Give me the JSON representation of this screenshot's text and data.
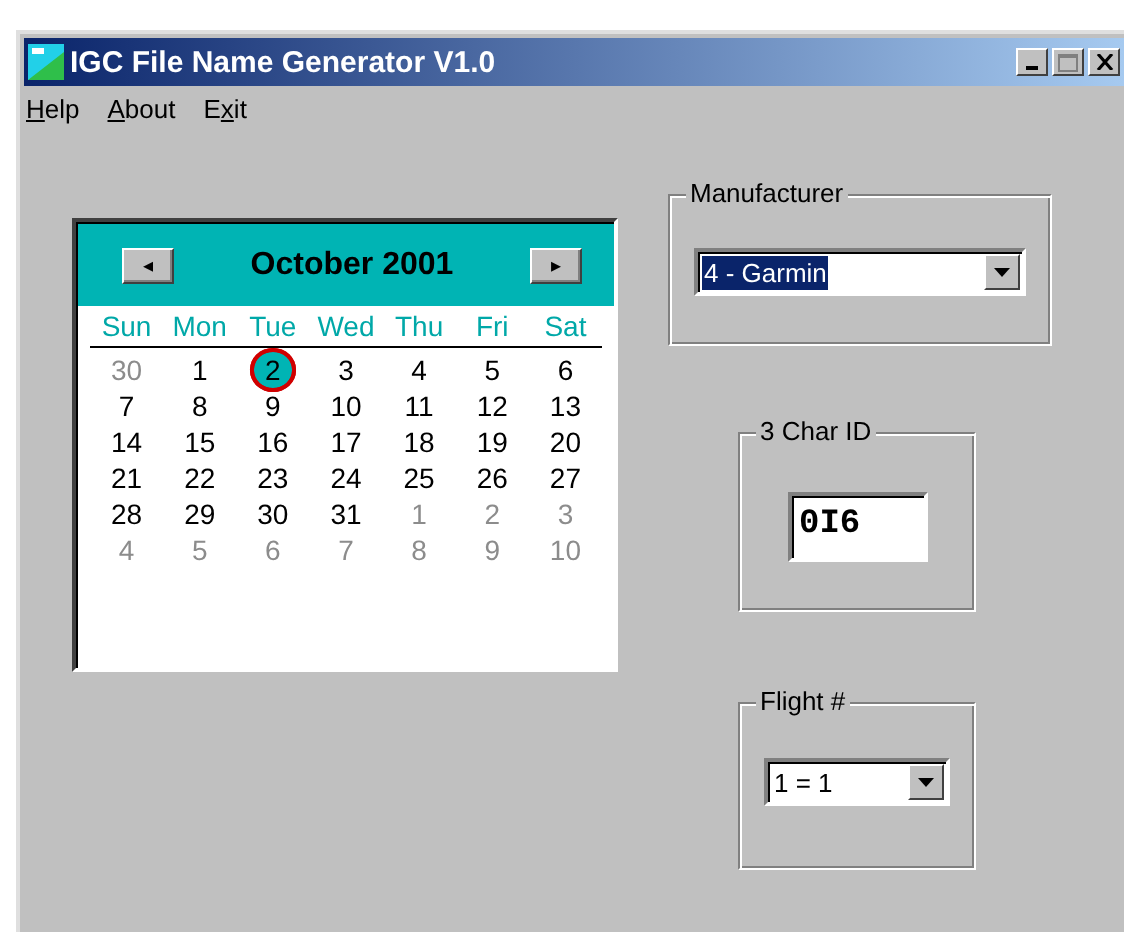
{
  "window": {
    "title": "IGC File Name Generator V1.0"
  },
  "menu": [
    {
      "label": "Help",
      "first_letter_underlined": true,
      "second_letter_underlined": false
    },
    {
      "label": "About",
      "first_letter_underlined": true,
      "second_letter_underlined": false
    },
    {
      "label": "Exit",
      "first_letter_underlined": false,
      "second_letter_underlined": true
    }
  ],
  "calendar": {
    "month": "October 2001",
    "prev": "◂",
    "next": "▸",
    "weekdays": [
      "Sun",
      "Mon",
      "Tue",
      "Wed",
      "Thu",
      "Fri",
      "Sat"
    ],
    "weeks": [
      [
        {
          "day": "30",
          "in_month": false,
          "selected": false,
          "circled": false
        },
        {
          "day": "1",
          "in_month": true,
          "selected": false,
          "circled": false
        },
        {
          "day": "2",
          "in_month": true,
          "selected": true,
          "circled": true
        },
        {
          "day": "3",
          "in_month": true,
          "selected": false,
          "circled": false
        },
        {
          "day": "4",
          "in_month": true,
          "selected": false,
          "circled": false
        },
        {
          "day": "5",
          "in_month": true,
          "selected": false,
          "circled": false
        },
        {
          "day": "6",
          "in_month": true,
          "selected": false,
          "circled": false
        }
      ],
      [
        {
          "day": "7",
          "in_month": true,
          "selected": false,
          "circled": false
        },
        {
          "day": "8",
          "in_month": true,
          "selected": false,
          "circled": false
        },
        {
          "day": "9",
          "in_month": true,
          "selected": false,
          "circled": false
        },
        {
          "day": "10",
          "in_month": true,
          "selected": false,
          "circled": false
        },
        {
          "day": "11",
          "in_month": true,
          "selected": false,
          "circled": false
        },
        {
          "day": "12",
          "in_month": true,
          "selected": false,
          "circled": false
        },
        {
          "day": "13",
          "in_month": true,
          "selected": false,
          "circled": false
        }
      ],
      [
        {
          "day": "14",
          "in_month": true,
          "selected": false,
          "circled": false
        },
        {
          "day": "15",
          "in_month": true,
          "selected": false,
          "circled": false
        },
        {
          "day": "16",
          "in_month": true,
          "selected": false,
          "circled": false
        },
        {
          "day": "17",
          "in_month": true,
          "selected": false,
          "circled": false
        },
        {
          "day": "18",
          "in_month": true,
          "selected": false,
          "circled": false
        },
        {
          "day": "19",
          "in_month": true,
          "selected": false,
          "circled": false
        },
        {
          "day": "20",
          "in_month": true,
          "selected": false,
          "circled": false
        }
      ],
      [
        {
          "day": "21",
          "in_month": true,
          "selected": false,
          "circled": false
        },
        {
          "day": "22",
          "in_month": true,
          "selected": false,
          "circled": false
        },
        {
          "day": "23",
          "in_month": true,
          "selected": false,
          "circled": false
        },
        {
          "day": "24",
          "in_month": true,
          "selected": false,
          "circled": false
        },
        {
          "day": "25",
          "in_month": true,
          "selected": false,
          "circled": false
        },
        {
          "day": "26",
          "in_month": true,
          "selected": false,
          "circled": false
        },
        {
          "day": "27",
          "in_month": true,
          "selected": false,
          "circled": false
        }
      ],
      [
        {
          "day": "28",
          "in_month": true,
          "selected": false,
          "circled": false
        },
        {
          "day": "29",
          "in_month": true,
          "selected": false,
          "circled": false
        },
        {
          "day": "30",
          "in_month": true,
          "selected": false,
          "circled": false
        },
        {
          "day": "31",
          "in_month": true,
          "selected": false,
          "circled": false
        },
        {
          "day": "1",
          "in_month": false,
          "selected": false,
          "circled": false
        },
        {
          "day": "2",
          "in_month": false,
          "selected": false,
          "circled": false
        },
        {
          "day": "3",
          "in_month": false,
          "selected": false,
          "circled": false
        }
      ],
      [
        {
          "day": "4",
          "in_month": false,
          "selected": false,
          "circled": false
        },
        {
          "day": "5",
          "in_month": false,
          "selected": false,
          "circled": false
        },
        {
          "day": "6",
          "in_month": false,
          "selected": false,
          "circled": false
        },
        {
          "day": "7",
          "in_month": false,
          "selected": false,
          "circled": false
        },
        {
          "day": "8",
          "in_month": false,
          "selected": false,
          "circled": false
        },
        {
          "day": "9",
          "in_month": false,
          "selected": false,
          "circled": false
        },
        {
          "day": "10",
          "in_month": false,
          "selected": false,
          "circled": false
        }
      ]
    ]
  },
  "manufacturer": {
    "label": "Manufacturer",
    "value": "4 - Garmin",
    "highlighted": true
  },
  "char_id": {
    "label": "3 Char ID",
    "value": "0I6"
  },
  "flight": {
    "label": "Flight #",
    "value": "1 = 1",
    "highlighted": false
  }
}
